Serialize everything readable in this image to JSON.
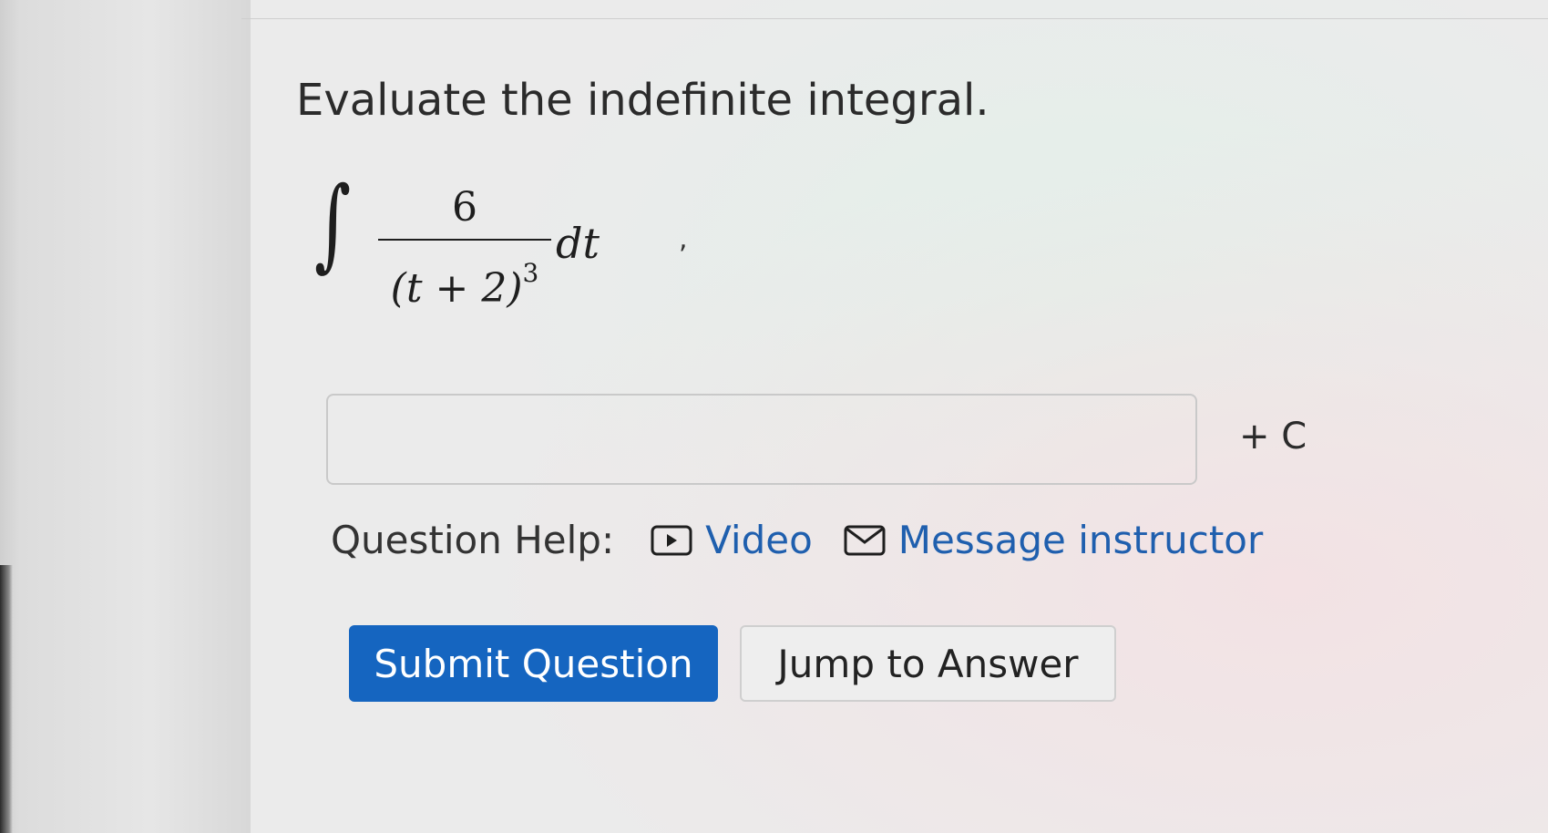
{
  "question": {
    "prompt": "Evaluate the indefinite integral.",
    "integral": {
      "sign": "∫",
      "numerator": "6",
      "denominator_base": "(t + 2)",
      "denominator_exponent": "3",
      "differential": "dt",
      "trailing_mark": ","
    }
  },
  "answer": {
    "value": "",
    "placeholder": "",
    "suffix": "+ C"
  },
  "help": {
    "label": "Question Help:",
    "links": [
      {
        "label": "Video",
        "icon": "play-box-icon"
      },
      {
        "label": "Message instructor",
        "icon": "envelope-icon"
      }
    ]
  },
  "buttons": {
    "submit": "Submit Question",
    "jump": "Jump to Answer"
  },
  "colors": {
    "primary": "#1565c0",
    "link": "#1f5fae"
  }
}
